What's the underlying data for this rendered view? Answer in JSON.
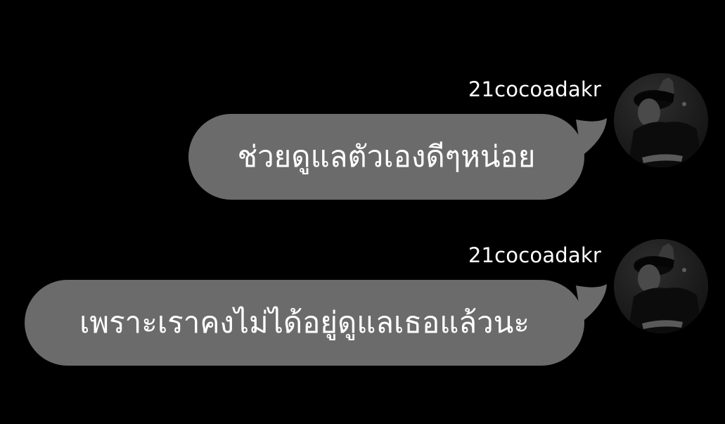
{
  "messages": [
    {
      "sender": "21cocoadakr",
      "text": "ช่วยดูแลตัวเองดีๆหน่อย"
    },
    {
      "sender": "21cocoadakr",
      "text": "เพราะเราคงไม่ได้อยู่ดูแลเธอแล้วนะ"
    }
  ],
  "colors": {
    "background": "#000000",
    "bubble": "#6b6b6b",
    "text": "#ffffff"
  },
  "icons": {
    "avatar": "profile-photo-avatar"
  }
}
